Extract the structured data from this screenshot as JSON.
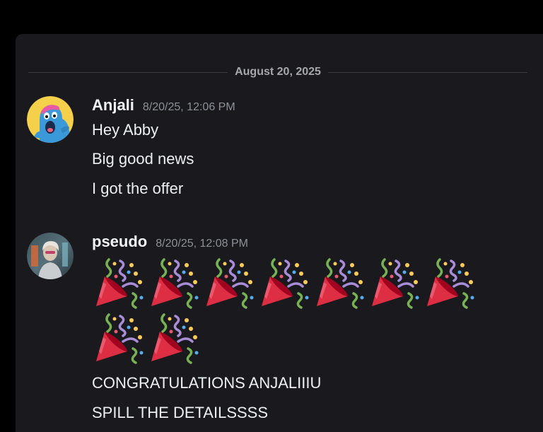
{
  "divider": {
    "date": "August 20, 2025"
  },
  "messages": [
    {
      "author": "Anjali",
      "timestamp": "8/20/25, 12:06 PM",
      "avatar_icon": "blue-monster-avatar",
      "lines": [
        "Hey Abby",
        "Big good news",
        "I got the offer"
      ]
    },
    {
      "author": "pseudo",
      "timestamp": "8/20/25, 12:08 PM",
      "avatar_icon": "person-photo-avatar",
      "emoji": {
        "name": "party-popper-icon",
        "count": 9
      },
      "lines": [
        "CONGRATULATIONS ANJALIIIU",
        "SPILL THE DETAILSSSS"
      ]
    }
  ],
  "colors": {
    "background": "#1a1a1e",
    "author": "#f2f3f5",
    "timestamp": "#8e9098",
    "message_text": "#eceef0",
    "avatar_yellow": "#f5d04a",
    "avatar_blue": "#3a9ad9"
  }
}
